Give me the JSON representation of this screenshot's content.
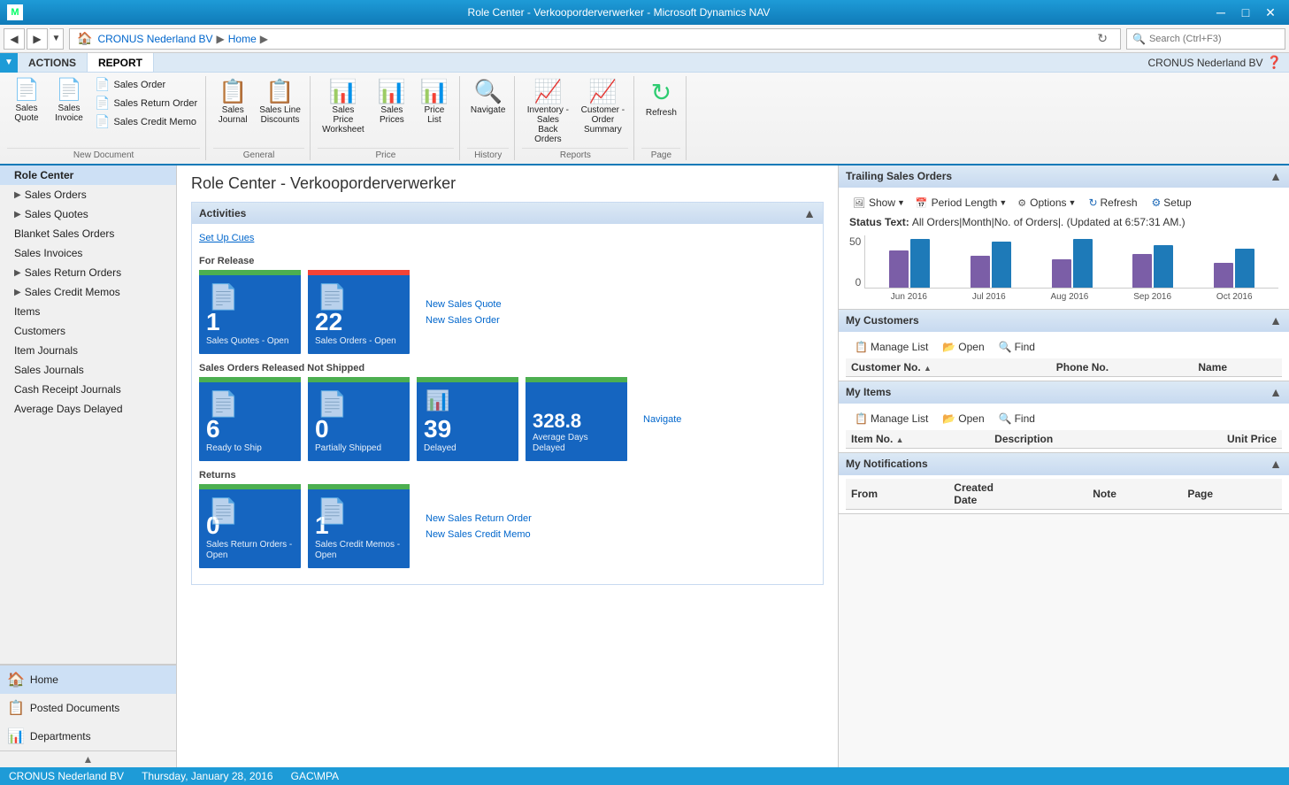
{
  "titleBar": {
    "title": "Role Center - Verkooporderverwerker - Microsoft Dynamics NAV",
    "minimize": "─",
    "restore": "□",
    "close": "✕"
  },
  "navBar": {
    "address": [
      "CRONUS Nederland BV",
      "Home"
    ],
    "searchPlaceholder": "Search (Ctrl+F3)"
  },
  "ribbon": {
    "tabs": [
      "ACTIONS",
      "REPORT"
    ],
    "dropdown": "▼",
    "company": "CRONUS Nederland BV",
    "groups": {
      "newDocument": {
        "label": "New Document",
        "items": [
          {
            "label": "Sales Quote",
            "icon": "📄",
            "type": "large"
          },
          {
            "label": "Sales Invoice",
            "icon": "📄",
            "type": "large"
          },
          {
            "smalls": [
              "Sales Order",
              "Sales Return Order",
              "Sales Credit Memo"
            ]
          }
        ]
      },
      "general": {
        "label": "General",
        "items": [
          {
            "label": "Sales Journal",
            "type": "large"
          },
          {
            "label": "Sales Line Discounts",
            "type": "large"
          }
        ]
      },
      "price": {
        "label": "Price",
        "items": [
          {
            "label": "Sales Price Worksheet",
            "type": "large"
          },
          {
            "label": "Sales Prices",
            "type": "large"
          },
          {
            "label": "Price List",
            "type": "large"
          }
        ]
      },
      "history": {
        "label": "History",
        "items": [
          {
            "label": "Navigate",
            "type": "large"
          }
        ]
      },
      "reports": {
        "label": "Reports",
        "items": [
          {
            "label": "Inventory - Sales Back Orders",
            "type": "large"
          },
          {
            "label": "Customer - Order Summary",
            "type": "large"
          }
        ]
      },
      "page": {
        "label": "Page",
        "items": [
          {
            "label": "Refresh",
            "type": "large"
          }
        ]
      }
    }
  },
  "sidebar": {
    "activeItem": "Role Center",
    "items": [
      {
        "label": "Role Center",
        "active": true
      },
      {
        "label": "Sales Orders",
        "hasChildren": true
      },
      {
        "label": "Sales Quotes",
        "hasChildren": true
      },
      {
        "label": "Blanket Sales Orders"
      },
      {
        "label": "Sales Invoices"
      },
      {
        "label": "Sales Return Orders",
        "hasChildren": true
      },
      {
        "label": "Sales Credit Memos",
        "hasChildren": true
      },
      {
        "label": "Items"
      },
      {
        "label": "Customers"
      },
      {
        "label": "Item Journals"
      },
      {
        "label": "Sales Journals"
      },
      {
        "label": "Cash Receipt Journals"
      },
      {
        "label": "Average Days Delayed"
      }
    ],
    "footerItems": [
      {
        "label": "Home",
        "icon": "🏠",
        "active": true
      },
      {
        "label": "Posted Documents",
        "icon": "📋"
      },
      {
        "label": "Departments",
        "icon": "📊"
      }
    ]
  },
  "pageTitle": "Role Center - Verkooporderverwerker",
  "activities": {
    "title": "Activities",
    "setupCues": "Set Up Cues",
    "forRelease": {
      "label": "For Release",
      "tiles": [
        {
          "number": "1",
          "label": "Sales Quotes - Open",
          "topBarColor": "#4caf50",
          "bgColor": "#1565c0"
        },
        {
          "number": "22",
          "label": "Sales Orders - Open",
          "topBarColor": "#f44336",
          "bgColor": "#1565c0"
        }
      ],
      "links": [
        "New Sales Quote",
        "New Sales Order"
      ]
    },
    "releasedNotShipped": {
      "label": "Sales Orders Released Not Shipped",
      "tiles": [
        {
          "number": "6",
          "label": "Ready to Ship",
          "topBarColor": "#4caf50",
          "bgColor": "#1565c0"
        },
        {
          "number": "0",
          "label": "Partially Shipped",
          "topBarColor": "#4caf50",
          "bgColor": "#1565c0"
        },
        {
          "number": "39",
          "label": "Delayed",
          "topBarColor": "#4caf50",
          "bgColor": "#1565c0"
        },
        {
          "number": "328.8",
          "label": "Average Days Delayed",
          "topBarColor": "#4caf50",
          "bgColor": "#1565c0"
        }
      ],
      "links": [
        "Navigate"
      ]
    },
    "returns": {
      "label": "Returns",
      "tiles": [
        {
          "number": "0",
          "label": "Sales Return Orders - Open",
          "topBarColor": "#4caf50",
          "bgColor": "#1565c0"
        },
        {
          "number": "1",
          "label": "Sales Credit Memos - Open",
          "topBarColor": "#4caf50",
          "bgColor": "#1565c0"
        }
      ],
      "links": [
        "New Sales Return Order",
        "New Sales Credit Memo"
      ]
    }
  },
  "trailingSalesOrders": {
    "title": "Trailing Sales Orders",
    "toolbar": {
      "show": "Show",
      "periodLength": "Period Length",
      "options": "Options",
      "refresh": "Refresh",
      "setup": "Setup"
    },
    "statusText": "All Orders|Month|No. of Orders|. (Updated at 6:57:31 AM.)",
    "chart": {
      "yLabels": [
        "50",
        "0"
      ],
      "months": [
        {
          "label": "Jun 2016",
          "purple": 35,
          "blue": 50
        },
        {
          "label": "Jul 2016",
          "purple": 30,
          "blue": 48
        },
        {
          "label": "Aug 2016",
          "purple": 28,
          "blue": 50
        },
        {
          "label": "Sep 2016",
          "purple": 32,
          "blue": 45
        },
        {
          "label": "Oct 2016",
          "purple": 25,
          "blue": 42
        }
      ]
    }
  },
  "myCustomers": {
    "title": "My Customers",
    "toolbar": {
      "manageList": "Manage List",
      "open": "Open",
      "find": "Find"
    },
    "columns": [
      "Customer No.",
      "Phone No.",
      "Name"
    ],
    "rows": []
  },
  "myItems": {
    "title": "My Items",
    "toolbar": {
      "manageList": "Manage List",
      "open": "Open",
      "find": "Find"
    },
    "columns": [
      "Item No.",
      "Description",
      "Unit Price"
    ],
    "rows": []
  },
  "myNotifications": {
    "title": "My Notifications",
    "columns": [
      "From",
      "Created Date",
      "Note",
      "Page"
    ],
    "rows": []
  },
  "statusBar": {
    "company": "CRONUS Nederland BV",
    "date": "Thursday, January 28, 2016",
    "user": "GAC\\MPA"
  }
}
